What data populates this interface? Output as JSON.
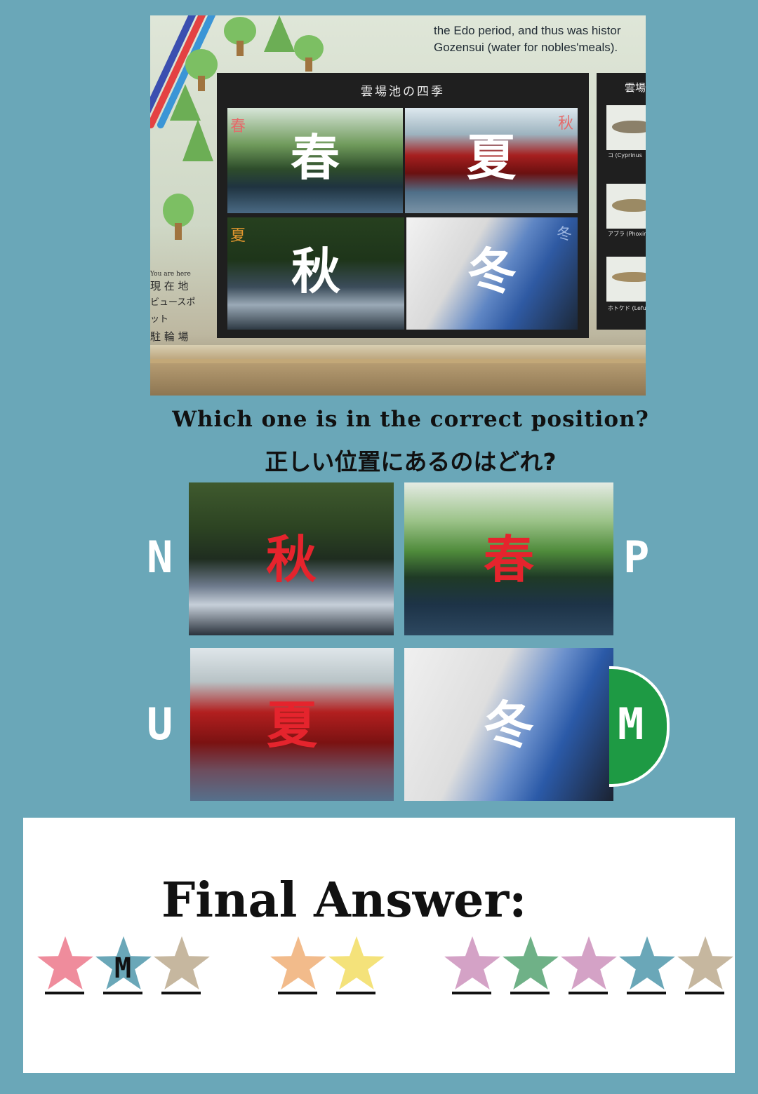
{
  "sign": {
    "english_text": "the Edo period, and thus was histor\nGozensui (water for nobles'meals).",
    "panel_title": "雲場池の四季",
    "panel_corners": [
      "春",
      "秋",
      "夏",
      "冬"
    ],
    "seasons": [
      "春",
      "夏",
      "秋",
      "冬"
    ],
    "side_title": "雲場",
    "fish_captions": [
      "コ (Cyprinus",
      "アブラ (Phoxinus la",
      "ホトケド (Lefua ech"
    ],
    "legend": [
      "You are here",
      "現 在 地",
      "ビュースポット",
      "駐 輪 場"
    ]
  },
  "question": {
    "english": "Which one is in the correct position?",
    "japanese": "正しい位置にあるのはどれ?"
  },
  "options": [
    {
      "letter": "N",
      "season": "秋",
      "label_color": "#e5242d"
    },
    {
      "letter": "P",
      "season": "春",
      "label_color": "#e5242d"
    },
    {
      "letter": "U",
      "season": "夏",
      "label_color": "#e5242d"
    },
    {
      "letter": "M",
      "season": "冬",
      "label_color": "#ffffff",
      "selected": true
    }
  ],
  "answer": {
    "title": "Final Answer:",
    "slots": [
      {
        "color": "#ef8c9c",
        "char": ""
      },
      {
        "color": "#6aa7b8",
        "char": "M"
      },
      {
        "color": "#c6b79f",
        "char": ""
      },
      {
        "color": "#f2bb8b",
        "char": ""
      },
      {
        "color": "#f4e27a",
        "char": ""
      },
      {
        "color": "#d4a2c6",
        "char": ""
      },
      {
        "color": "#6fb187",
        "char": ""
      },
      {
        "color": "#d4a2c6",
        "char": ""
      },
      {
        "color": "#6aa7b8",
        "char": ""
      },
      {
        "color": "#c6b79f",
        "char": ""
      }
    ]
  },
  "colors": {
    "background": "#6aa7b8",
    "selected_badge": "#1e9a44"
  }
}
